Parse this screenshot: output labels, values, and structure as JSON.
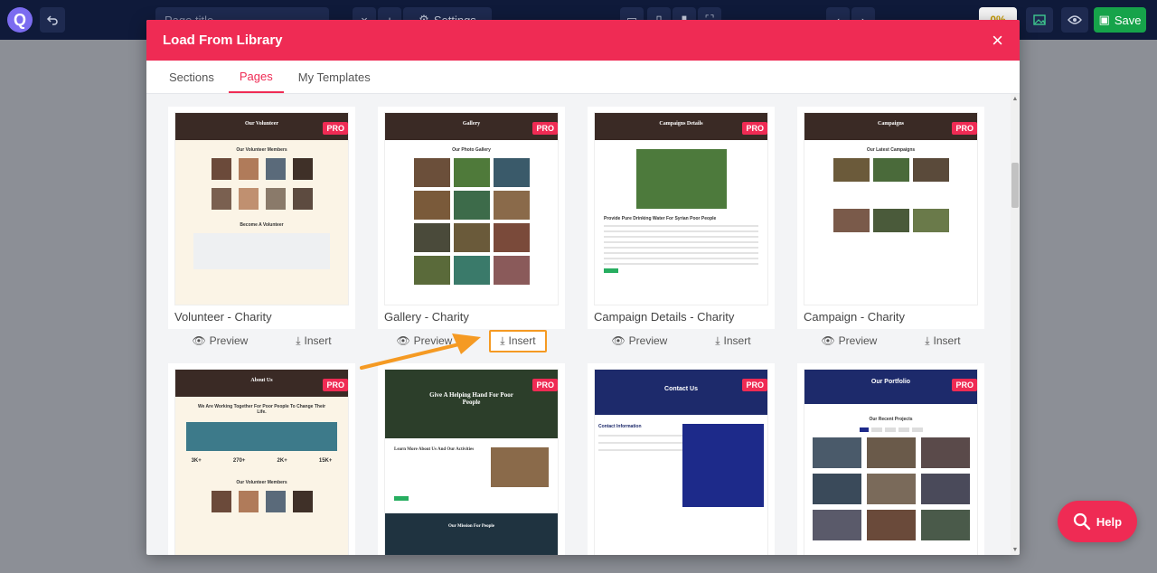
{
  "toolbar": {
    "page_title_placeholder": "Page title",
    "settings_label": "Settings",
    "progress": "0%",
    "save_label": "Save"
  },
  "modal": {
    "title": "Load From Library",
    "close": "×",
    "tabs": [
      {
        "label": "Sections",
        "active": false
      },
      {
        "label": "Pages",
        "active": true
      },
      {
        "label": "My Templates",
        "active": false
      }
    ]
  },
  "cards": [
    {
      "name": "Volunteer - Charity",
      "hero": "Our Volunteer",
      "sub": "Our Volunteer Members",
      "sub2": "Become A Volunteer",
      "badge": "PRO",
      "preview": "Preview",
      "insert": "Insert"
    },
    {
      "name": "Gallery - Charity",
      "hero": "Gallery",
      "sub": "Our Photo Gallery",
      "badge": "PRO",
      "preview": "Preview",
      "insert": "Insert"
    },
    {
      "name": "Campaign Details - Charity",
      "hero": "Campaigns Details",
      "sub": "Provide Pure Drinking Water For Syrian Poor People",
      "badge": "PRO",
      "preview": "Preview",
      "insert": "Insert"
    },
    {
      "name": "Campaign - Charity",
      "hero": "Campaigns",
      "sub": "Our Latest Campaigns",
      "badge": "PRO",
      "preview": "Preview",
      "insert": "Insert"
    },
    {
      "hero": "About Us",
      "sub": "We Are Working Together For Poor People To Change Their Life.",
      "stats": [
        "3K+",
        "270+",
        "2K+",
        "15K+"
      ],
      "sub2": "Our Volunteer Members",
      "badge": "PRO"
    },
    {
      "hero": "Give A Helping Hand For Poor People",
      "sub": "Learn More About Us And Our Activities",
      "sub2": "Our Mission For People",
      "badge": "PRO"
    },
    {
      "hero": "Contact Us",
      "sub": "Contact Information",
      "badge": "PRO"
    },
    {
      "hero": "Our Portfolio",
      "sub": "Our Recent Projects",
      "badge": "PRO"
    }
  ],
  "help_label": "Help",
  "colors": {
    "accent": "#ef2b54",
    "highlight": "#f59a23",
    "save": "#16a34a"
  }
}
